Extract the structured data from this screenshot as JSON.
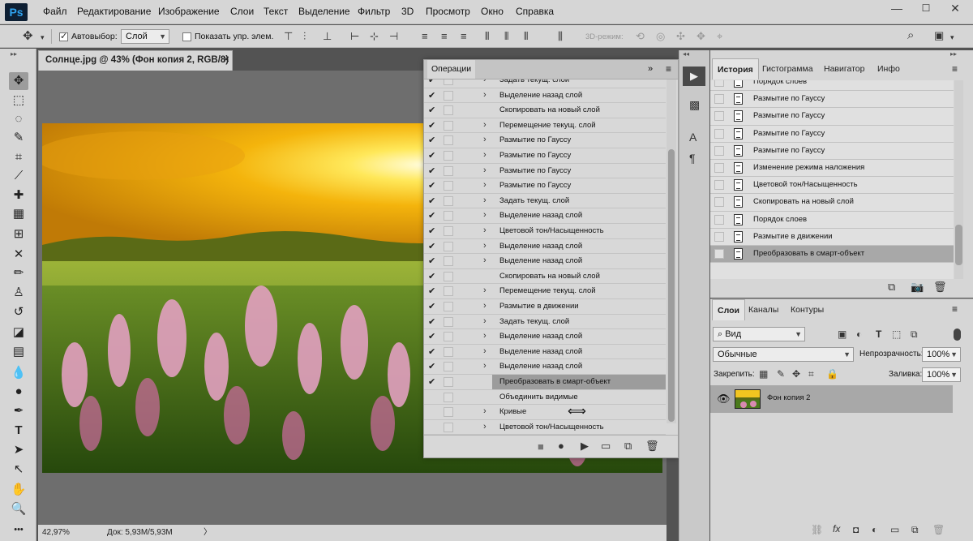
{
  "app": {
    "logo": "Ps"
  },
  "menu": [
    "Файл",
    "Редактирование",
    "Изображение",
    "Слои",
    "Текст",
    "Выделение",
    "Фильтр",
    "3D",
    "Просмотр",
    "Окно",
    "Справка"
  ],
  "window_controls": [
    "—",
    "☐",
    "✕"
  ],
  "options": {
    "auto_select_label": "Автовыбор:",
    "auto_select_value": "Слой",
    "show_controls_label": "Показать упр. элем.",
    "mode_3d_label": "3D-режим:"
  },
  "document": {
    "tab_title": "Солнце.jpg @ 43% (Фон копия 2, RGB/8) *",
    "zoom": "42,97%",
    "doc_info": "Док: 5,93M/5,93M"
  },
  "operations": {
    "title": "Операции",
    "rows": [
      {
        "label": "Задать текущ. слой",
        "checked": true,
        "expand": true
      },
      {
        "label": "Выделение назад слой",
        "checked": true,
        "expand": true
      },
      {
        "label": "Скопировать на новый слой",
        "checked": true,
        "expand": false
      },
      {
        "label": "Перемещение текущ. слой",
        "checked": true,
        "expand": true
      },
      {
        "label": "Размытие по Гауссу",
        "checked": true,
        "expand": true
      },
      {
        "label": "Размытие по Гауссу",
        "checked": true,
        "expand": true
      },
      {
        "label": "Размытие по Гауссу",
        "checked": true,
        "expand": true
      },
      {
        "label": "Размытие по Гауссу",
        "checked": true,
        "expand": true
      },
      {
        "label": "Задать текущ. слой",
        "checked": true,
        "expand": true
      },
      {
        "label": "Выделение назад слой",
        "checked": true,
        "expand": true
      },
      {
        "label": "Цветовой тон/Насыщенность",
        "checked": true,
        "expand": true
      },
      {
        "label": "Выделение назад слой",
        "checked": true,
        "expand": true
      },
      {
        "label": "Выделение назад слой",
        "checked": true,
        "expand": true
      },
      {
        "label": "Скопировать на новый слой",
        "checked": true,
        "expand": false
      },
      {
        "label": "Перемещение текущ. слой",
        "checked": true,
        "expand": true
      },
      {
        "label": "Размытие в движении",
        "checked": true,
        "expand": true
      },
      {
        "label": "Задать текущ. слой",
        "checked": true,
        "expand": true
      },
      {
        "label": "Выделение назад слой",
        "checked": true,
        "expand": true
      },
      {
        "label": "Выделение назад слой",
        "checked": true,
        "expand": true
      },
      {
        "label": "Выделение назад слой",
        "checked": true,
        "expand": true
      },
      {
        "label": "Преобразовать в смарт-объект",
        "checked": true,
        "expand": false,
        "selected": true
      },
      {
        "label": "Объединить видимые",
        "checked": false,
        "expand": false
      },
      {
        "label": "Кривые",
        "checked": false,
        "expand": true
      },
      {
        "label": "Цветовой тон/Насыщенность",
        "checked": false,
        "expand": true
      }
    ]
  },
  "history": {
    "tabs": [
      "История",
      "Гистограмма",
      "Навигатор",
      "Инфо"
    ],
    "rows": [
      {
        "label": "Порядок слоев"
      },
      {
        "label": "Размытие по Гауссу"
      },
      {
        "label": "Размытие по Гауссу"
      },
      {
        "label": "Размытие по Гауссу"
      },
      {
        "label": "Размытие по Гауссу"
      },
      {
        "label": "Изменение режима наложения"
      },
      {
        "label": "Цветовой тон/Насыщенность"
      },
      {
        "label": "Скопировать на новый слой"
      },
      {
        "label": "Порядок слоев"
      },
      {
        "label": "Размытие в движении"
      },
      {
        "label": "Преобразовать в смарт-объект",
        "selected": true
      }
    ]
  },
  "layers": {
    "tabs": [
      "Слои",
      "Каналы",
      "Контуры"
    ],
    "filter_value": "Вид",
    "blend_mode": "Обычные",
    "opacity_label": "Непрозрачность:",
    "opacity_value": "100%",
    "lock_label": "Закрепить:",
    "fill_label": "Заливка:",
    "fill_value": "100%",
    "items": [
      {
        "name": "Фон копия 2",
        "visible": true
      }
    ]
  }
}
